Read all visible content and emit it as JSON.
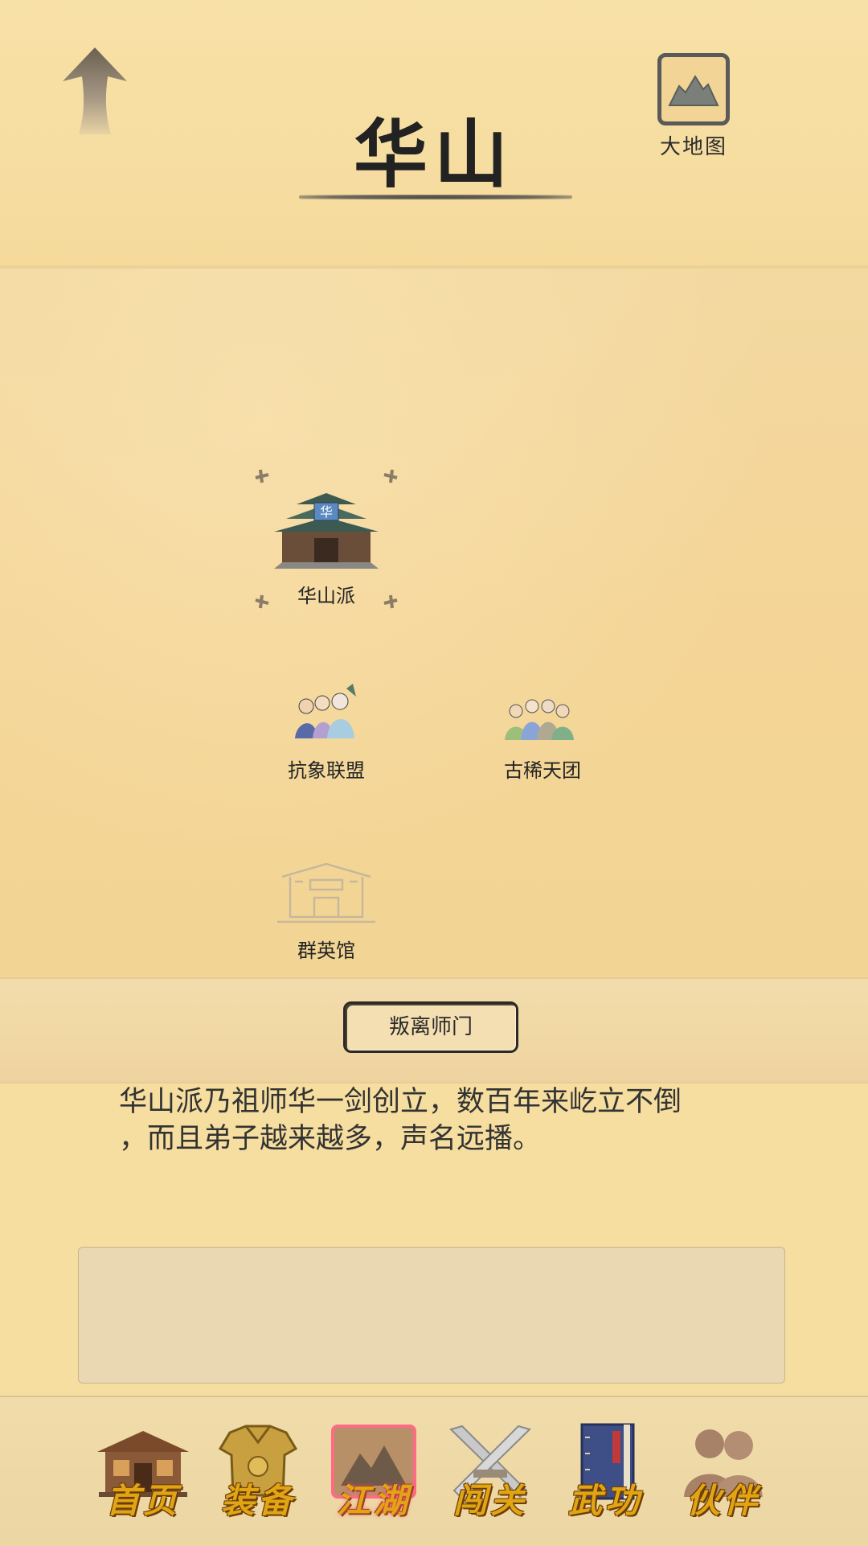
{
  "header": {
    "title": "华山",
    "map_label": "大地图"
  },
  "locations": [
    {
      "id": "huashan-sect",
      "label": "华山派",
      "selected": true
    },
    {
      "id": "kangxiang-alliance",
      "label": "抗象联盟",
      "selected": false
    },
    {
      "id": "guxi-tiantuan",
      "label": "古稀天团",
      "selected": false
    },
    {
      "id": "qunying-hall",
      "label": "群英馆",
      "selected": false
    }
  ],
  "banner": {
    "leave_button": "叛离师门"
  },
  "description": {
    "line1": "华山派乃祖师华一剑创立，数百年来屹立不倒",
    "line2": "，而且弟子越来越多，声名远播。"
  },
  "nav": {
    "items": [
      {
        "label": "首页",
        "icon": "house-icon",
        "active": false
      },
      {
        "label": "装备",
        "icon": "armor-icon",
        "active": false
      },
      {
        "label": "江湖",
        "icon": "scroll-map-icon",
        "active": true
      },
      {
        "label": "闯关",
        "icon": "crossed-swords-icon",
        "active": false
      },
      {
        "label": "武功",
        "icon": "book-icon",
        "active": false
      },
      {
        "label": "伙伴",
        "icon": "people-icon",
        "active": false
      }
    ]
  },
  "colors": {
    "background": "#f6dea0",
    "nav_label": "#e1a514",
    "nav_label_outline": "#6b3c08",
    "active_glow": "#ff4b6b"
  }
}
